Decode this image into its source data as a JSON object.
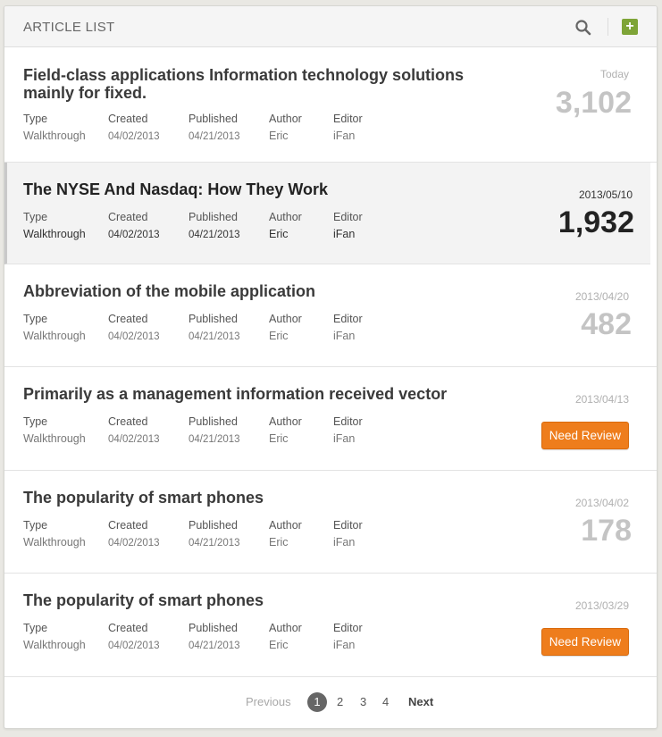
{
  "header": {
    "title": "ARTICLE LIST",
    "search_icon": "search-icon",
    "add_icon": "plus-icon",
    "add_glyph": "+",
    "accent_color": "#7ea437"
  },
  "meta_labels": {
    "type": "Type",
    "created": "Created",
    "published": "Published",
    "author": "Author",
    "editor": "Editor"
  },
  "articles": [
    {
      "title": "Field-class applications Information technology solutions mainly for fixed.",
      "type": "Walkthrough",
      "created": "04/02/2013",
      "published": "04/21/2013",
      "author": "Eric",
      "editor": "iFan",
      "date": "Today",
      "count": "3,102"
    },
    {
      "title": "The NYSE And Nasdaq: How They Work",
      "type": "Walkthrough",
      "created": "04/02/2013",
      "published": "04/21/2013",
      "author": "Eric",
      "editor": "iFan",
      "date": "2013/05/10",
      "count": "1,932",
      "active": true
    },
    {
      "title": "Abbreviation of the mobile application",
      "type": "Walkthrough",
      "created": "04/02/2013",
      "published": "04/21/2013",
      "author": "Eric",
      "editor": "iFan",
      "date": "2013/04/20",
      "count": "482"
    },
    {
      "title": "Primarily as a management information received vector",
      "type": "Walkthrough",
      "created": "04/02/2013",
      "published": "04/21/2013",
      "author": "Eric",
      "editor": "iFan",
      "date": "2013/04/13",
      "action": "Need Review"
    },
    {
      "title": "The popularity of smart phones",
      "type": "Walkthrough",
      "created": "04/02/2013",
      "published": "04/21/2013",
      "author": "Eric",
      "editor": "iFan",
      "date": "2013/04/02",
      "count": "178"
    },
    {
      "title": "The popularity of smart phones",
      "type": "Walkthrough",
      "created": "04/02/2013",
      "published": "04/21/2013",
      "author": "Eric",
      "editor": "iFan",
      "date": "2013/03/29",
      "action": "Need Review"
    }
  ],
  "pagination": {
    "previous": "Previous",
    "pages": [
      "1",
      "2",
      "3",
      "4"
    ],
    "current": "1",
    "next": "Next"
  },
  "colors": {
    "button": "#ee7d1c",
    "current_page": "#666666"
  }
}
